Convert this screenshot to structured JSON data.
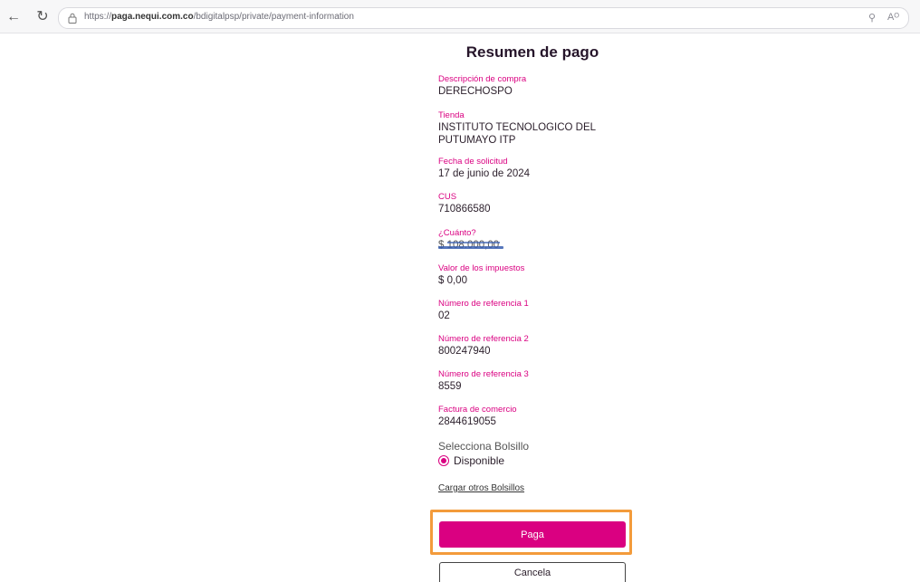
{
  "browser": {
    "url_prefix": "https://",
    "url_domain": "paga.nequi.com.co",
    "url_path": "/bdigitalpsp/private/payment-information"
  },
  "page": {
    "title": "Resumen de pago"
  },
  "fields": [
    {
      "label": "Descripción de compra",
      "value": "DERECHOSPO"
    },
    {
      "label": "Tienda",
      "value": "INSTITUTO TECNOLOGICO DEL PUTUMAYO ITP"
    },
    {
      "label": "Fecha de solicitud",
      "value": "17 de junio de 2024"
    },
    {
      "label": "CUS",
      "value": "710866580"
    },
    {
      "label": "¿Cuánto?",
      "value": "$ 108.000,00"
    },
    {
      "label": "Valor de los impuestos",
      "value": "$ 0,00"
    },
    {
      "label": "Número de referencia 1",
      "value": "02"
    },
    {
      "label": "Número de referencia 2",
      "value": "800247940"
    },
    {
      "label": "Número de referencia 3",
      "value": "8559"
    },
    {
      "label": "Factura de comercio",
      "value": "2844619055"
    }
  ],
  "pocket": {
    "heading": "Selecciona Bolsillo",
    "option": "Disponible",
    "load_link": "Cargar otros Bolsillos"
  },
  "actions": {
    "pay_label": "Paga",
    "cancel_label": "Cancela"
  },
  "colors": {
    "accent": "#da0081",
    "highlight": "#f39b3b"
  }
}
